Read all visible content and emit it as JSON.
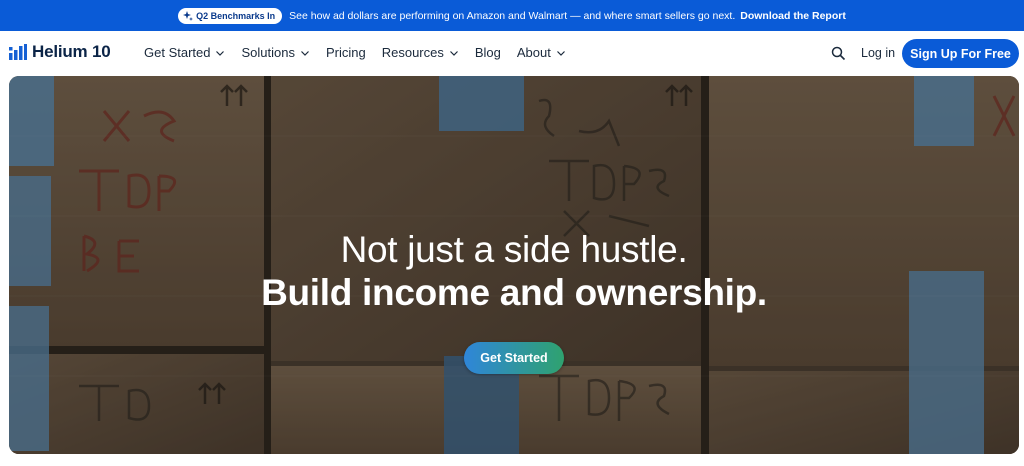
{
  "announcement": {
    "badge_label": "Q2 Benchmarks In",
    "badge_icon": "sparkle-icon",
    "message": "See how ad dollars are performing on Amazon and Walmart — and where smart sellers go next.",
    "link_label": "Download the Report",
    "bg_color": "#0a5bd7"
  },
  "nav": {
    "logo_text": "Helium 10",
    "logo_icon": "bar-chart-icon",
    "items": [
      {
        "label": "Get Started",
        "has_dropdown": true
      },
      {
        "label": "Solutions",
        "has_dropdown": true
      },
      {
        "label": "Pricing",
        "has_dropdown": false
      },
      {
        "label": "Resources",
        "has_dropdown": true
      },
      {
        "label": "Blog",
        "has_dropdown": false
      },
      {
        "label": "About",
        "has_dropdown": true
      }
    ],
    "search_icon": "search-icon",
    "login_label": "Log in",
    "signup_label": "Sign Up For Free",
    "accent_color": "#0a5bd7"
  },
  "hero": {
    "title": "Not just a side hustle.",
    "subtitle": "Build income and ownership.",
    "cta_label": "Get Started",
    "background_description_icon": "cardboard-boxes-image"
  }
}
